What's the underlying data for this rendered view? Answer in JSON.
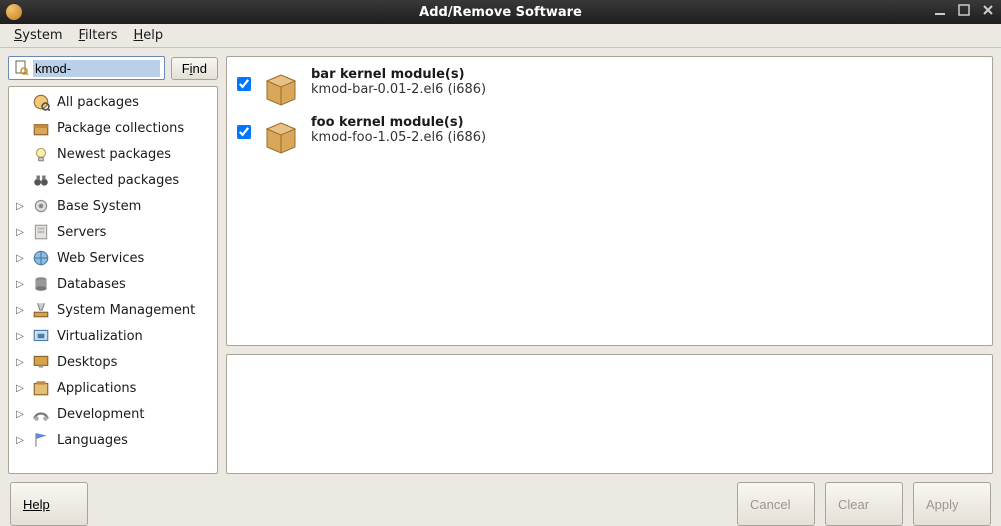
{
  "window": {
    "title": "Add/Remove Software"
  },
  "menubar": [
    {
      "label": "System",
      "accel": "S"
    },
    {
      "label": "Filters",
      "accel": "F"
    },
    {
      "label": "Help",
      "accel": "H"
    }
  ],
  "search": {
    "value": "kmod-",
    "find_label": "Find",
    "find_accel": "i"
  },
  "sidebar_quick": [
    {
      "label": "All packages",
      "icon": "globe-search-icon"
    },
    {
      "label": "Package collections",
      "icon": "box-collection-icon"
    },
    {
      "label": "Newest packages",
      "icon": "bulb-icon"
    },
    {
      "label": "Selected packages",
      "icon": "binoculars-icon"
    }
  ],
  "sidebar_categories": [
    {
      "label": "Base System",
      "icon": "gear-icon"
    },
    {
      "label": "Servers",
      "icon": "server-icon"
    },
    {
      "label": "Web Services",
      "icon": "web-icon"
    },
    {
      "label": "Databases",
      "icon": "database-icon"
    },
    {
      "label": "System Management",
      "icon": "tools-icon"
    },
    {
      "label": "Virtualization",
      "icon": "virt-icon"
    },
    {
      "label": "Desktops",
      "icon": "desktop-icon"
    },
    {
      "label": "Applications",
      "icon": "apps-icon"
    },
    {
      "label": "Development",
      "icon": "dev-icon"
    },
    {
      "label": "Languages",
      "icon": "flag-icon"
    }
  ],
  "packages": [
    {
      "checked": true,
      "name": "bar kernel module(s)",
      "version": "kmod-bar-0.01-2.el6 (i686)"
    },
    {
      "checked": true,
      "name": "foo kernel module(s)",
      "version": "kmod-foo-1.05-2.el6 (i686)"
    }
  ],
  "footer": {
    "help": "Help",
    "cancel": "Cancel",
    "clear": "Clear",
    "apply": "Apply"
  }
}
